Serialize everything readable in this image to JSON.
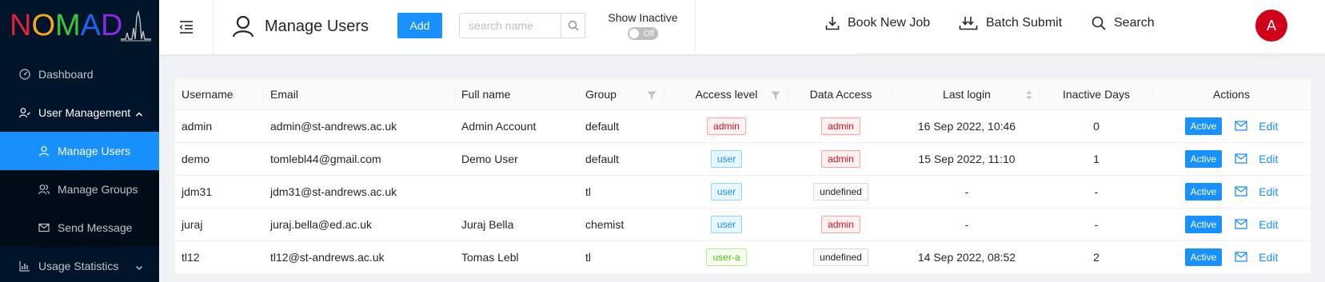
{
  "logo": {
    "text": "NOMAD",
    "letters": [
      {
        "ch": "N",
        "color": "#e0233c"
      },
      {
        "ch": "O",
        "color": "#f5a623"
      },
      {
        "ch": "M",
        "color": "#3cc63c"
      },
      {
        "ch": "A",
        "color": "#1c64f2"
      },
      {
        "ch": "D",
        "color": "#8a2be2"
      }
    ]
  },
  "sidebar": {
    "items": [
      {
        "label": "Dashboard",
        "icon": "dashboard-icon"
      },
      {
        "label": "User Management",
        "icon": "user-management-icon",
        "open": true
      },
      {
        "label": "Usage Statistics",
        "icon": "bar-chart-icon"
      }
    ],
    "submenu": [
      {
        "label": "Manage Users",
        "icon": "user-icon",
        "selected": true
      },
      {
        "label": "Manage Groups",
        "icon": "team-icon"
      },
      {
        "label": "Send Message",
        "icon": "mail-icon"
      }
    ]
  },
  "header": {
    "title": "Manage Users",
    "add_label": "Add",
    "search_placeholder": "search name",
    "show_inactive_label": "Show Inactive",
    "toggle_text": "Off",
    "book_new_job": "Book New Job",
    "batch_submit": "Batch Submit",
    "search": "Search",
    "avatar_letter": "A"
  },
  "table": {
    "columns": [
      "Username",
      "Email",
      "Full name",
      "Group",
      "Access level",
      "Data Access",
      "Last login",
      "Inactive Days",
      "Actions"
    ],
    "rows": [
      {
        "username": "admin",
        "email": "admin@st-andrews.ac.uk",
        "fullname": "Admin Account",
        "group": "default",
        "access": "admin",
        "access_color": "red",
        "data_access": "admin",
        "data_color": "red",
        "last_login": "16 Sep 2022, 10:46",
        "inactive": "0",
        "status": "Active",
        "edit": "Edit"
      },
      {
        "username": "demo",
        "email": "tomlebl44@gmail.com",
        "fullname": "Demo User",
        "group": "default",
        "access": "user",
        "access_color": "blue",
        "data_access": "admin",
        "data_color": "red",
        "last_login": "15 Sep 2022, 11:10",
        "inactive": "1",
        "status": "Active",
        "edit": "Edit"
      },
      {
        "username": "jdm31",
        "email": "jdm31@st-andrews.ac.uk",
        "fullname": "",
        "group": "tl",
        "access": "user",
        "access_color": "blue",
        "data_access": "undefined",
        "data_color": "default",
        "last_login": "-",
        "inactive": "-",
        "status": "Active",
        "edit": "Edit"
      },
      {
        "username": "juraj",
        "email": "juraj.bella@ed.ac.uk",
        "fullname": "Juraj Bella",
        "group": "chemist",
        "access": "user",
        "access_color": "blue",
        "data_access": "admin",
        "data_color": "red",
        "last_login": "-",
        "inactive": "-",
        "status": "Active",
        "edit": "Edit"
      },
      {
        "username": "tl12",
        "email": "tl12@st-andrews.ac.uk",
        "fullname": "Tomas Lebl",
        "group": "tl",
        "access": "user-a",
        "access_color": "green",
        "data_access": "undefined",
        "data_color": "default",
        "last_login": "14 Sep 2022, 08:52",
        "inactive": "2",
        "status": "Active",
        "edit": "Edit"
      }
    ]
  },
  "colors": {
    "primary": "#1890ff",
    "sidebar_bg": "#001529",
    "avatar_bg": "#d0021b"
  }
}
